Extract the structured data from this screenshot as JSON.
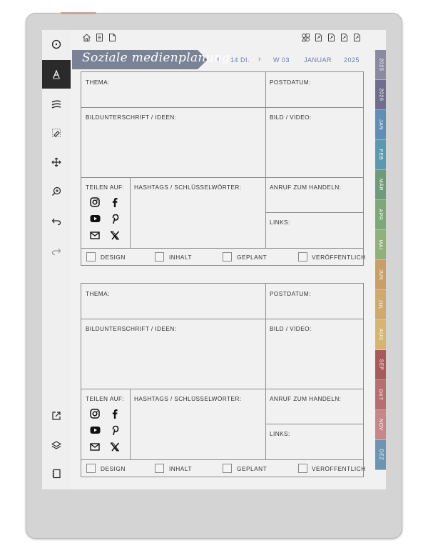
{
  "title": "Soziale medienplanung",
  "nav": {
    "prev_symbol": "‹",
    "day": "14 DI.",
    "next_symbol": "›",
    "week": "W 03",
    "month": "JANUAR",
    "year": "2025"
  },
  "labels": {
    "thema": "THEMA:",
    "postdatum": "POSTDATUM:",
    "caption": "BILDUNTERSCHRIFT / IDEEN:",
    "media": "BILD / VIDEO:",
    "share": "TEILEN AUF:",
    "hashtags": "HASHTAGS / SCHLÜSSELWÖRTER:",
    "cta": "ANRUF ZUM HANDELN:",
    "links": "LINKS:",
    "design": "DESIGN",
    "inhalt": "INHALT",
    "geplant": "GEPLANT",
    "veroeffentlicht": "VERÖFFENTLICH"
  },
  "tabs": [
    {
      "label": "2025",
      "color": "#8a8aa0"
    },
    {
      "label": "2026",
      "color": "#6f6f8d"
    },
    {
      "label": "JAN",
      "color": "#5f8fb4"
    },
    {
      "label": "FEB",
      "color": "#5a9ab0"
    },
    {
      "label": "MÄR",
      "color": "#6e9c7a"
    },
    {
      "label": "APR",
      "color": "#7fa877"
    },
    {
      "label": "MAI",
      "color": "#92b07c"
    },
    {
      "label": "JUN",
      "color": "#c99f66"
    },
    {
      "label": "JUL",
      "color": "#d0aa6c"
    },
    {
      "label": "AUG",
      "color": "#d8b56f"
    },
    {
      "label": "SEP",
      "color": "#a85a5a"
    },
    {
      "label": "OKT",
      "color": "#b86e70"
    },
    {
      "label": "NOV",
      "color": "#c78789"
    },
    {
      "label": "DEZ",
      "color": "#6b95b3"
    }
  ],
  "colors": {
    "banner": "#7a8296",
    "nav_text": "#6a7ab0",
    "grid": "#8c8c8c"
  }
}
